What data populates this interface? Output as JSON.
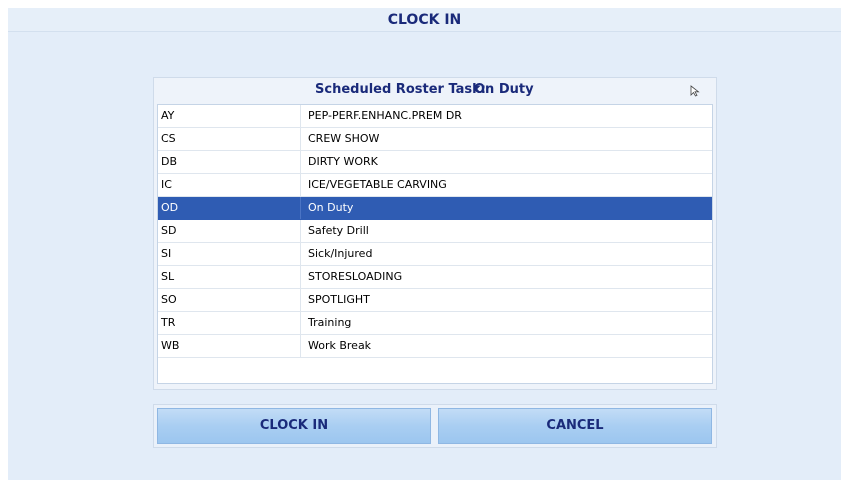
{
  "window": {
    "title": "CLOCK IN"
  },
  "roster": {
    "label": "Scheduled Roster Task:",
    "value": "On Duty"
  },
  "tasks": [
    {
      "code": "AY",
      "description": "PEP-PERF.ENHANC.PREM DR",
      "selected": false
    },
    {
      "code": "CS",
      "description": "CREW SHOW",
      "selected": false
    },
    {
      "code": "DB",
      "description": "DIRTY WORK",
      "selected": false
    },
    {
      "code": "IC",
      "description": "ICE/VEGETABLE CARVING",
      "selected": false
    },
    {
      "code": "OD",
      "description": "On Duty",
      "selected": true
    },
    {
      "code": "SD",
      "description": "Safety Drill",
      "selected": false
    },
    {
      "code": "SI",
      "description": "Sick/Injured",
      "selected": false
    },
    {
      "code": "SL",
      "description": "STORESLOADING",
      "selected": false
    },
    {
      "code": "SO",
      "description": "SPOTLIGHT",
      "selected": false
    },
    {
      "code": "TR",
      "description": "Training",
      "selected": false
    },
    {
      "code": "WB",
      "description": "Work Break",
      "selected": false
    }
  ],
  "buttons": {
    "clock_in": "CLOCK IN",
    "cancel": "CANCEL"
  },
  "colors": {
    "title_text": "#1a2a7a",
    "selection": "#2f5cb3",
    "background": "#e3edf9"
  },
  "icons": {
    "cursor": "mouse-pointer-icon"
  }
}
